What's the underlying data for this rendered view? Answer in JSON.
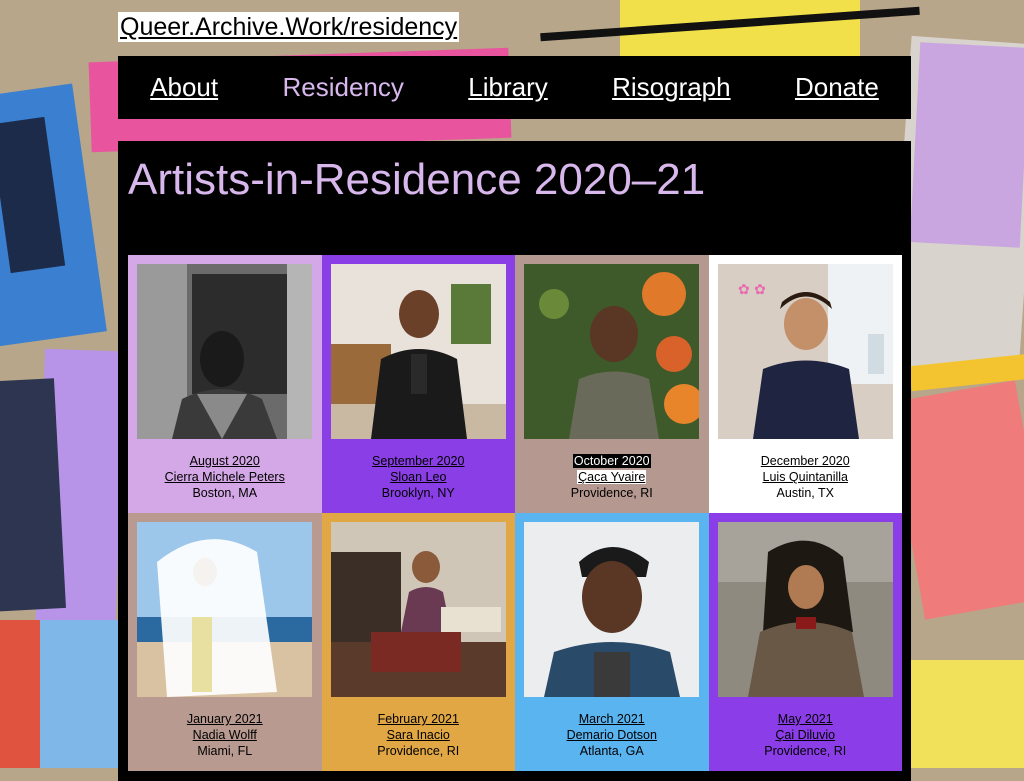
{
  "site": {
    "title": "Queer.Archive.Work/residency"
  },
  "nav": [
    {
      "label": "About"
    },
    {
      "label": "Residency"
    },
    {
      "label": "Library"
    },
    {
      "label": "Risograph"
    },
    {
      "label": "Donate"
    }
  ],
  "page": {
    "heading": "Artists-in-Residence 2020–21"
  },
  "residents": [
    {
      "month": "August 2020",
      "name": "Cierra Michele Peters",
      "location": "Boston, MA"
    },
    {
      "month": "September 2020",
      "name": "Sloan Leo",
      "location": "Brooklyn, NY"
    },
    {
      "month": "October 2020",
      "name": "Çaca Yvaire",
      "location": "Providence, RI"
    },
    {
      "month": "December 2020",
      "name": "Luis Quintanilla",
      "location": "Austin, TX"
    },
    {
      "month": "January 2021",
      "name": "Nadia Wolff",
      "location": "Miami, FL"
    },
    {
      "month": "February 2021",
      "name": "Sara Inacio",
      "location": "Providence, RI"
    },
    {
      "month": "March 2021",
      "name": "Demario Dotson",
      "location": "Atlanta, GA"
    },
    {
      "month": "May 2021",
      "name": "Çai Diluvio",
      "location": "Providence, RI"
    }
  ],
  "colors": {
    "accent": "#d8b7ec",
    "cell_lilac": "#d4a8e6",
    "cell_purple": "#8a3ee6",
    "cell_mauve": "#b59890",
    "cell_white": "#ffffff",
    "cell_tan": "#b89a90",
    "cell_orange": "#e0a744",
    "cell_sky": "#5ab4f0",
    "cell_violet": "#8b3ee8"
  }
}
